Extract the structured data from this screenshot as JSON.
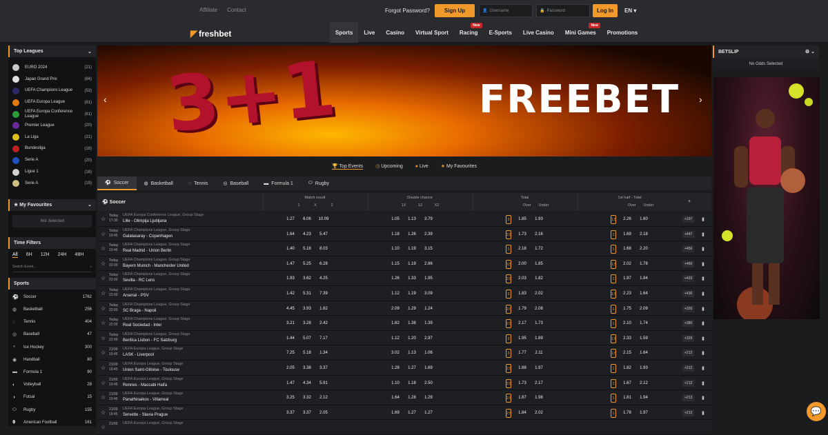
{
  "header": {
    "affiliate": "Affiliate",
    "contact": "Contact",
    "forgot": "Forgot Password?",
    "signup": "Sign Up",
    "username_ph": "Username",
    "password_ph": "Password",
    "login": "Log In",
    "lang": "EN"
  },
  "logo": "freshbet",
  "nav": [
    {
      "label": "Sports",
      "active": true
    },
    {
      "label": "Live"
    },
    {
      "label": "Casino"
    },
    {
      "label": "Virtual Sport"
    },
    {
      "label": "Racing",
      "badge": "New"
    },
    {
      "label": "E-Sports"
    },
    {
      "label": "Live Casino"
    },
    {
      "label": "Mini Games",
      "badge": "New"
    },
    {
      "label": "Promotions"
    }
  ],
  "top_leagues": {
    "title": "Top Leagues",
    "items": [
      {
        "name": "EURO 2024",
        "count": "(21)",
        "color": "#c9c9c9"
      },
      {
        "name": "Japan Grand Prix",
        "count": "(84)",
        "color": "#e0e0e0"
      },
      {
        "name": "UEFA Champions League",
        "count": "(53)",
        "color": "#2a2a6a"
      },
      {
        "name": "UEFA Europa League",
        "count": "(81)",
        "color": "#e07a10"
      },
      {
        "name": "UEFA Europa Conference League",
        "count": "(81)",
        "color": "#2d9a3a"
      },
      {
        "name": "Premier League",
        "count": "(20)",
        "color": "#6a2a9a"
      },
      {
        "name": "La Liga",
        "count": "(21)",
        "color": "#e0c020"
      },
      {
        "name": "Bundesliga",
        "count": "(18)",
        "color": "#c02020"
      },
      {
        "name": "Serie A",
        "count": "(20)",
        "color": "#2050c0"
      },
      {
        "name": "Ligue 1",
        "count": "(18)",
        "color": "#d0d0d0"
      },
      {
        "name": "Serie A",
        "count": "(19)",
        "color": "#d0c080"
      }
    ]
  },
  "favourites": {
    "title": "My Favourites",
    "empty": "Not Selected"
  },
  "time_filters": {
    "title": "Time Filters",
    "options": [
      "All",
      "6H",
      "12H",
      "24H",
      "48H"
    ],
    "search_ph": "Search Event..."
  },
  "sports": {
    "title": "Sports",
    "items": [
      {
        "name": "Soccer",
        "count": "1762",
        "icon": "⚽"
      },
      {
        "name": "Basketball",
        "count": "256",
        "icon": "◍"
      },
      {
        "name": "Tennis",
        "count": "404",
        "icon": "◌"
      },
      {
        "name": "Baseball",
        "count": "47",
        "icon": "◎"
      },
      {
        "name": "Ice Hockey",
        "count": "300",
        "icon": "♆"
      },
      {
        "name": "Handball",
        "count": "80",
        "icon": "◉"
      },
      {
        "name": "Formula 1",
        "count": "90",
        "icon": "▬"
      },
      {
        "name": "Volleyball",
        "count": "28",
        "icon": "◐"
      },
      {
        "name": "Futsal",
        "count": "15",
        "icon": "◑"
      },
      {
        "name": "Rugby",
        "count": "155",
        "icon": "⬭"
      },
      {
        "name": "American Football",
        "count": "161",
        "icon": "⬮"
      }
    ]
  },
  "banner": {
    "big": "3+1",
    "text": "FREEBET"
  },
  "event_filters": [
    "Top Events",
    "Upcoming",
    "Live",
    "My Favourites"
  ],
  "sport_tabs": [
    {
      "label": "Soccer",
      "icon": "⚽"
    },
    {
      "label": "Basketball",
      "icon": "◍"
    },
    {
      "label": "Tennis",
      "icon": "◌"
    },
    {
      "label": "Baseball",
      "icon": "◎"
    },
    {
      "label": "Formula 1",
      "icon": "▬"
    },
    {
      "label": "Rugby",
      "icon": "⬭"
    }
  ],
  "table": {
    "sport": "Soccer",
    "groups": [
      {
        "title": "Match result",
        "cols": [
          "1",
          "X",
          "2"
        ]
      },
      {
        "title": "Double chance",
        "cols": [
          "1X",
          "12",
          "X2"
        ]
      },
      {
        "title": "Total",
        "cols": [
          "Over",
          "Under"
        ]
      },
      {
        "title": "1st half - Total",
        "cols": [
          "Over",
          "Under"
        ]
      }
    ],
    "plus": "+"
  },
  "matches": [
    {
      "date": "Today",
      "time": "17:30",
      "league": "UEFA Europa Conference League, Group Stage",
      "home": "Lille",
      "away": "Olimpija Ljubljana",
      "mr": [
        "1.27",
        "6.06",
        "10.09"
      ],
      "dc": [
        "1.05",
        "1.13",
        "3.79"
      ],
      "tl": "3",
      "tot": [
        "1.85",
        "1.93"
      ],
      "hl": "1.5",
      "half": [
        "2.26",
        "1.60"
      ],
      "more": "+197"
    },
    {
      "date": "Today",
      "time": "19:45",
      "league": "UEFA Champions League, Group Stage",
      "home": "Galatasaray",
      "away": "Copenhagen",
      "mr": [
        "1.64",
        "4.23",
        "5.47"
      ],
      "dc": [
        "1.18",
        "1.26",
        "2.39"
      ],
      "tl": "2.5",
      "tot": [
        "1.73",
        "2.16"
      ],
      "hl": "1",
      "half": [
        "1.69",
        "2.18"
      ],
      "more": "+447"
    },
    {
      "date": "Today",
      "time": "19:45",
      "league": "UEFA Champions League, Group Stage",
      "home": "Real Madrid",
      "away": "Union Berlin",
      "mr": [
        "1.40",
        "5.18",
        "8.03"
      ],
      "dc": [
        "1.10",
        "1.19",
        "3.15"
      ],
      "tl": "3",
      "tot": [
        "2.18",
        "1.72"
      ],
      "hl": "1",
      "half": [
        "1.68",
        "2.20"
      ],
      "more": "+456"
    },
    {
      "date": "Today",
      "time": "22:00",
      "league": "UEFA Champions League, Group Stage",
      "home": "Bayern Munich",
      "away": "Manchester United",
      "mr": [
        "1.47",
        "5.25",
        "6.28"
      ],
      "dc": [
        "1.15",
        "1.19",
        "2.86"
      ],
      "tl": "3.5",
      "tot": [
        "2.00",
        "1.85"
      ],
      "hl": "1.5",
      "half": [
        "2.02",
        "1.78"
      ],
      "more": "+460"
    },
    {
      "date": "Today",
      "time": "22:00",
      "league": "UEFA Champions League, Group Stage",
      "home": "Sevilla",
      "away": "RC Lens",
      "mr": [
        "1.93",
        "3.62",
        "4.25"
      ],
      "dc": [
        "1.26",
        "1.33",
        "1.95"
      ],
      "tl": "2.5",
      "tot": [
        "2.03",
        "1.82"
      ],
      "hl": "1",
      "half": [
        "1.97",
        "1.84"
      ],
      "more": "+433"
    },
    {
      "date": "Today",
      "time": "22:00",
      "league": "UEFA Champions League, Group Stage",
      "home": "Arsenal",
      "away": "PSV",
      "mr": [
        "1.42",
        "5.31",
        "7.39"
      ],
      "dc": [
        "1.12",
        "1.19",
        "3.09"
      ],
      "tl": "3",
      "tot": [
        "1.83",
        "2.02"
      ],
      "hl": "1.5",
      "half": [
        "2.23",
        "1.64"
      ],
      "more": "+436"
    },
    {
      "date": "Today",
      "time": "22:00",
      "league": "UEFA Champions League, Group Stage",
      "home": "SC Braga",
      "away": "Napoli",
      "mr": [
        "4.45",
        "3.93",
        "1.82"
      ],
      "dc": [
        "2.09",
        "1.29",
        "1.24"
      ],
      "tl": "2.5",
      "tot": [
        "1.79",
        "2.08"
      ],
      "hl": "1",
      "half": [
        "1.75",
        "2.09"
      ],
      "more": "+326"
    },
    {
      "date": "Today",
      "time": "22:00",
      "league": "UEFA Champions League, Group Stage",
      "home": "Real Sociedad",
      "away": "Inter",
      "mr": [
        "3.21",
        "3.28",
        "2.42"
      ],
      "dc": [
        "1.62",
        "1.38",
        "1.39"
      ],
      "tl": "2.5",
      "tot": [
        "2.17",
        "1.73"
      ],
      "hl": "1",
      "half": [
        "2.10",
        "1.74"
      ],
      "more": "+380"
    },
    {
      "date": "Today",
      "time": "22:00",
      "league": "UEFA Champions League, Group Stage",
      "home": "Benfica Lisbon",
      "away": "FC Salzburg",
      "mr": [
        "1.44",
        "5.07",
        "7.17"
      ],
      "dc": [
        "1.12",
        "1.20",
        "2.97"
      ],
      "tl": "3",
      "tot": [
        "1.95",
        "1.89"
      ],
      "hl": "1.5",
      "half": [
        "2.33",
        "1.59"
      ],
      "more": "+329"
    },
    {
      "date": "21/09",
      "time": "19:45",
      "league": "UEFA Europa League, Group Stage",
      "home": "LASK",
      "away": "Liverpool",
      "mr": [
        "7.25",
        "5.18",
        "1.34"
      ],
      "dc": [
        "3.02",
        "1.13",
        "1.06"
      ],
      "tl": "3",
      "tot": [
        "1.77",
        "2.11"
      ],
      "hl": "1.5",
      "half": [
        "2.15",
        "1.64"
      ],
      "more": "+212"
    },
    {
      "date": "21/09",
      "time": "19:45",
      "league": "UEFA Europa League, Group Stage",
      "home": "Union Saint-Gilloise",
      "away": "Toulouse",
      "mr": [
        "2.05",
        "3.38",
        "3.37"
      ],
      "dc": [
        "1.28",
        "1.27",
        "1.69"
      ],
      "tl": "2.5",
      "tot": [
        "1.88",
        "1.97"
      ],
      "hl": "1",
      "half": [
        "1.82",
        "1.93"
      ],
      "more": "+212"
    },
    {
      "date": "21/09",
      "time": "19:45",
      "league": "UEFA Europa League, Group Stage",
      "home": "Rennes",
      "away": "Maccabi Haifa",
      "mr": [
        "1.47",
        "4.34",
        "5.91"
      ],
      "dc": [
        "1.10",
        "1.18",
        "2.50"
      ],
      "tl": "2.5",
      "tot": [
        "1.73",
        "2.17"
      ],
      "hl": "1",
      "half": [
        "1.67",
        "2.12"
      ],
      "more": "+212"
    },
    {
      "date": "21/09",
      "time": "19:45",
      "league": "UEFA Europa League, Group Stage",
      "home": "Panathinaikos",
      "away": "Villarreal",
      "mr": [
        "3.25",
        "3.32",
        "2.12"
      ],
      "dc": [
        "1.64",
        "1.28",
        "1.29"
      ],
      "tl": "2.5",
      "tot": [
        "1.87",
        "1.98"
      ],
      "hl": "1",
      "half": [
        "1.81",
        "1.94"
      ],
      "more": "+213"
    },
    {
      "date": "21/09",
      "time": "19:45",
      "league": "UEFA Europa League, Group Stage",
      "home": "Servette",
      "away": "Slavia Prague",
      "mr": [
        "3.37",
        "3.37",
        "2.05"
      ],
      "dc": [
        "1.69",
        "1.27",
        "1.27"
      ],
      "tl": "2.5",
      "tot": [
        "1.84",
        "2.02"
      ],
      "hl": "1",
      "half": [
        "1.78",
        "1.97"
      ],
      "more": "+212"
    },
    {
      "date": "21/09",
      "time": "",
      "league": "UEFA Europa League, Group Stage",
      "home": "",
      "away": "",
      "mr": [
        "",
        "",
        ""
      ],
      "dc": [
        "",
        "",
        ""
      ],
      "tl": "",
      "tot": [
        "",
        ""
      ],
      "hl": "",
      "half": [
        "",
        ""
      ],
      "more": ""
    }
  ],
  "betslip": {
    "title": "BETSLIP",
    "empty": "No Odds Selected"
  }
}
